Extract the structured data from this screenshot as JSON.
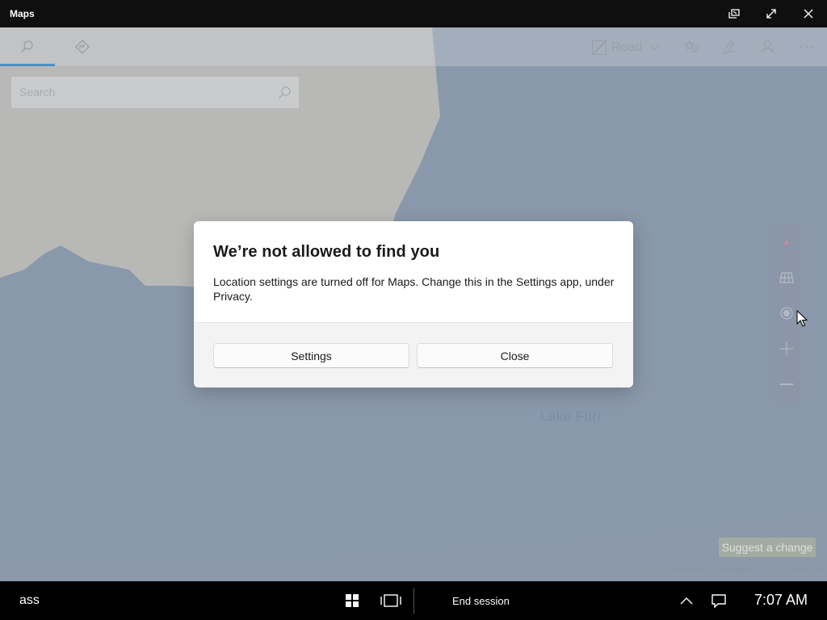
{
  "app": {
    "title": "Maps"
  },
  "title_bar": {
    "buttons": [
      {
        "name": "tablet-mode-icon"
      },
      {
        "name": "maximize-icon"
      },
      {
        "name": "close-icon"
      }
    ]
  },
  "toolbar": {
    "tabs": [
      {
        "name": "search-tab",
        "icon": "search-icon",
        "active": true
      },
      {
        "name": "directions-tab",
        "icon": "directions-icon",
        "active": false
      }
    ],
    "map_style": {
      "label": "Road",
      "icon": "map-style-icon"
    },
    "tools": [
      "favorites-icon",
      "ink-icon",
      "account-icon",
      "more-icon"
    ]
  },
  "search": {
    "placeholder": "Search",
    "value": ""
  },
  "map": {
    "lake_label": "Lake Fitri",
    "suggest_change": "Suggest a change",
    "copyright": "© 2022 Microsoft Corporation, © 2022 TomTom"
  },
  "map_controls": [
    "compass-icon",
    "3d-cities-icon",
    "show-location-icon",
    "zoom-in-icon",
    "zoom-out-icon"
  ],
  "dialog": {
    "title": "We’re not allowed to find you",
    "body": "Location settings are turned off for Maps. Change this in the Settings app, under Privacy.",
    "primary_button": "Settings",
    "secondary_button": "Close"
  },
  "taskbar": {
    "left_text": "ass",
    "end_session": "End session",
    "clock": "7:07 AM"
  },
  "colors": {
    "accent": "#4f8fc4",
    "water": "#8a98ab",
    "land": "#b8b9b7",
    "taskbar": "#000000"
  }
}
